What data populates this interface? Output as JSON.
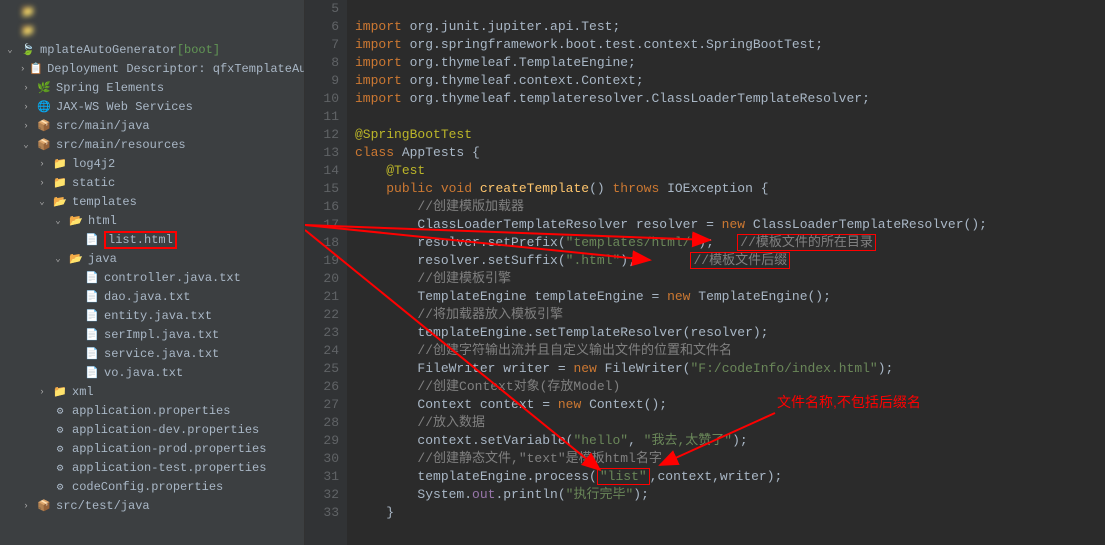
{
  "sidebar": {
    "items": [
      {
        "depth": 0,
        "expand": "",
        "icon": "root",
        "label": "",
        "blur": true
      },
      {
        "depth": 0,
        "expand": "",
        "icon": "project",
        "label": "",
        "blur": true
      },
      {
        "depth": 0,
        "expand": "v",
        "icon": "spring",
        "label": "mplateAutoGenerator",
        "suffix": " [boot]"
      },
      {
        "depth": 1,
        "expand": ">",
        "icon": "deploy",
        "label": "Deployment Descriptor: qfxTemplateAutoGe"
      },
      {
        "depth": 1,
        "expand": ">",
        "icon": "spring-leaf",
        "label": "Spring Elements"
      },
      {
        "depth": 1,
        "expand": ">",
        "icon": "globe",
        "label": "JAX-WS Web Services"
      },
      {
        "depth": 1,
        "expand": ">",
        "icon": "src",
        "label": "src/main/java"
      },
      {
        "depth": 1,
        "expand": "v",
        "icon": "src",
        "label": "src/main/resources"
      },
      {
        "depth": 2,
        "expand": ">",
        "icon": "folder",
        "label": "log4j2"
      },
      {
        "depth": 2,
        "expand": ">",
        "icon": "folder",
        "label": "static"
      },
      {
        "depth": 2,
        "expand": "v",
        "icon": "folder-open",
        "label": "templates"
      },
      {
        "depth": 3,
        "expand": "v",
        "icon": "folder-open",
        "label": "html"
      },
      {
        "depth": 4,
        "expand": "",
        "icon": "html",
        "label": "list.html",
        "highlight": true
      },
      {
        "depth": 3,
        "expand": "v",
        "icon": "folder-open",
        "label": "java"
      },
      {
        "depth": 4,
        "expand": "",
        "icon": "file",
        "label": "controller.java.txt"
      },
      {
        "depth": 4,
        "expand": "",
        "icon": "file",
        "label": "dao.java.txt"
      },
      {
        "depth": 4,
        "expand": "",
        "icon": "file",
        "label": "entity.java.txt"
      },
      {
        "depth": 4,
        "expand": "",
        "icon": "file",
        "label": "serImpl.java.txt"
      },
      {
        "depth": 4,
        "expand": "",
        "icon": "file",
        "label": "service.java.txt"
      },
      {
        "depth": 4,
        "expand": "",
        "icon": "file",
        "label": "vo.java.txt"
      },
      {
        "depth": 2,
        "expand": ">",
        "icon": "folder",
        "label": "xml"
      },
      {
        "depth": 2,
        "expand": "",
        "icon": "props",
        "label": "application.properties"
      },
      {
        "depth": 2,
        "expand": "",
        "icon": "props",
        "label": "application-dev.properties"
      },
      {
        "depth": 2,
        "expand": "",
        "icon": "props",
        "label": "application-prod.properties"
      },
      {
        "depth": 2,
        "expand": "",
        "icon": "props",
        "label": "application-test.properties"
      },
      {
        "depth": 2,
        "expand": "",
        "icon": "props",
        "label": "codeConfig.properties"
      },
      {
        "depth": 1,
        "expand": ">",
        "icon": "src",
        "label": "src/test/java"
      }
    ]
  },
  "code": {
    "lines": [
      {
        "n": 5,
        "tokens": []
      },
      {
        "n": 6,
        "tokens": [
          {
            "t": "import ",
            "c": "kw"
          },
          {
            "t": "org.junit.jupiter.api.Test;",
            "c": "cls"
          }
        ]
      },
      {
        "n": 7,
        "tokens": [
          {
            "t": "import ",
            "c": "kw"
          },
          {
            "t": "org.springframework.boot.test.context.SpringBootTest;",
            "c": "cls"
          }
        ]
      },
      {
        "n": 8,
        "tokens": [
          {
            "t": "import ",
            "c": "kw"
          },
          {
            "t": "org.thymeleaf.TemplateEngine;",
            "c": "cls"
          }
        ]
      },
      {
        "n": 9,
        "tokens": [
          {
            "t": "import ",
            "c": "kw"
          },
          {
            "t": "org.thymeleaf.context.Context;",
            "c": "cls"
          }
        ]
      },
      {
        "n": 10,
        "tokens": [
          {
            "t": "import ",
            "c": "kw"
          },
          {
            "t": "org.thymeleaf.templateresolver.ClassLoaderTemplateResolver;",
            "c": "cls"
          }
        ]
      },
      {
        "n": 11,
        "tokens": []
      },
      {
        "n": 12,
        "tokens": [
          {
            "t": "@SpringBootTest",
            "c": "anno"
          }
        ]
      },
      {
        "n": 13,
        "tokens": [
          {
            "t": "class ",
            "c": "kw"
          },
          {
            "t": "AppTests {",
            "c": "cls"
          }
        ]
      },
      {
        "n": 14,
        "tokens": [
          {
            "t": "    ",
            "c": ""
          },
          {
            "t": "@Test",
            "c": "anno"
          }
        ]
      },
      {
        "n": 15,
        "tokens": [
          {
            "t": "    ",
            "c": ""
          },
          {
            "t": "public void ",
            "c": "kw"
          },
          {
            "t": "createTemplate",
            "c": "meth"
          },
          {
            "t": "() ",
            "c": "cls"
          },
          {
            "t": "throws ",
            "c": "kw"
          },
          {
            "t": "IOException {",
            "c": "cls"
          }
        ]
      },
      {
        "n": 16,
        "tokens": [
          {
            "t": "        ",
            "c": ""
          },
          {
            "t": "//创建模版加载器",
            "c": "comment"
          }
        ]
      },
      {
        "n": 17,
        "tokens": [
          {
            "t": "        ",
            "c": ""
          },
          {
            "t": "ClassLoaderTemplateResolver resolver = ",
            "c": "cls"
          },
          {
            "t": "new ",
            "c": "kw"
          },
          {
            "t": "ClassLoaderTemplateResolver();",
            "c": "cls-new"
          }
        ]
      },
      {
        "n": 18,
        "tokens": [
          {
            "t": "        ",
            "c": ""
          },
          {
            "t": "resolver.setPrefix(",
            "c": "cls"
          },
          {
            "t": "\"templates/html/\"",
            "c": "str"
          },
          {
            "t": ");",
            "c": "cls"
          },
          {
            "t": "   ",
            "c": ""
          },
          {
            "t": "//模板文件的所在目录",
            "c": "comment",
            "box": true
          }
        ]
      },
      {
        "n": 19,
        "tokens": [
          {
            "t": "        ",
            "c": ""
          },
          {
            "t": "resolver.setSuffix(",
            "c": "cls"
          },
          {
            "t": "\".html\"",
            "c": "str"
          },
          {
            "t": ");",
            "c": "cls"
          },
          {
            "t": "       ",
            "c": ""
          },
          {
            "t": "//模板文件后缀",
            "c": "comment",
            "box": true
          }
        ]
      },
      {
        "n": 20,
        "tokens": [
          {
            "t": "        ",
            "c": ""
          },
          {
            "t": "//创建模板引擎",
            "c": "comment"
          }
        ]
      },
      {
        "n": 21,
        "tokens": [
          {
            "t": "        ",
            "c": ""
          },
          {
            "t": "TemplateEngine templateEngine = ",
            "c": "cls"
          },
          {
            "t": "new ",
            "c": "kw"
          },
          {
            "t": "TemplateEngine();",
            "c": "cls-new"
          }
        ]
      },
      {
        "n": 22,
        "tokens": [
          {
            "t": "        ",
            "c": ""
          },
          {
            "t": "//将加载器放入模板引擎",
            "c": "comment"
          }
        ]
      },
      {
        "n": 23,
        "tokens": [
          {
            "t": "        ",
            "c": ""
          },
          {
            "t": "templateEngine.setTemplateResolver(resolver);",
            "c": "cls"
          }
        ]
      },
      {
        "n": 24,
        "tokens": [
          {
            "t": "        ",
            "c": ""
          },
          {
            "t": "//创建字符输出流并且自定义输出文件的位置和文件名",
            "c": "comment"
          }
        ]
      },
      {
        "n": 25,
        "tokens": [
          {
            "t": "        ",
            "c": ""
          },
          {
            "t": "FileWriter writer = ",
            "c": "cls"
          },
          {
            "t": "new ",
            "c": "kw"
          },
          {
            "t": "FileWriter(",
            "c": "cls-new"
          },
          {
            "t": "\"F:/codeInfo/index.html\"",
            "c": "str"
          },
          {
            "t": ");",
            "c": "cls"
          }
        ]
      },
      {
        "n": 26,
        "tokens": [
          {
            "t": "        ",
            "c": ""
          },
          {
            "t": "//创建Context对象(存放Model)",
            "c": "comment"
          }
        ]
      },
      {
        "n": 27,
        "tokens": [
          {
            "t": "        ",
            "c": ""
          },
          {
            "t": "Context context = ",
            "c": "cls"
          },
          {
            "t": "new ",
            "c": "kw"
          },
          {
            "t": "Context();",
            "c": "cls-new"
          }
        ]
      },
      {
        "n": 28,
        "tokens": [
          {
            "t": "        ",
            "c": ""
          },
          {
            "t": "//放入数据",
            "c": "comment"
          }
        ]
      },
      {
        "n": 29,
        "tokens": [
          {
            "t": "        ",
            "c": ""
          },
          {
            "t": "context.setVariable(",
            "c": "cls"
          },
          {
            "t": "\"hello\"",
            "c": "str"
          },
          {
            "t": ", ",
            "c": "cls"
          },
          {
            "t": "\"我去,太赞了\"",
            "c": "str"
          },
          {
            "t": ");",
            "c": "cls"
          }
        ]
      },
      {
        "n": 30,
        "tokens": [
          {
            "t": "        ",
            "c": ""
          },
          {
            "t": "//创建静态文件,\"text\"是模板html名字",
            "c": "comment"
          }
        ]
      },
      {
        "n": 31,
        "tokens": [
          {
            "t": "        ",
            "c": ""
          },
          {
            "t": "templateEngine.process(",
            "c": "cls"
          },
          {
            "t": "\"list\"",
            "c": "str",
            "box": true
          },
          {
            "t": ",context,writer);",
            "c": "cls"
          }
        ]
      },
      {
        "n": 32,
        "tokens": [
          {
            "t": "        ",
            "c": ""
          },
          {
            "t": "System.",
            "c": "cls"
          },
          {
            "t": "out",
            "c": "field"
          },
          {
            "t": ".println(",
            "c": "cls"
          },
          {
            "t": "\"执行完毕\"",
            "c": "str"
          },
          {
            "t": ");",
            "c": "cls"
          }
        ]
      },
      {
        "n": 33,
        "tokens": [
          {
            "t": "    }",
            "c": "cls"
          }
        ]
      }
    ]
  },
  "annotations": {
    "filename_note": "文件名称,不包括后缀名"
  }
}
